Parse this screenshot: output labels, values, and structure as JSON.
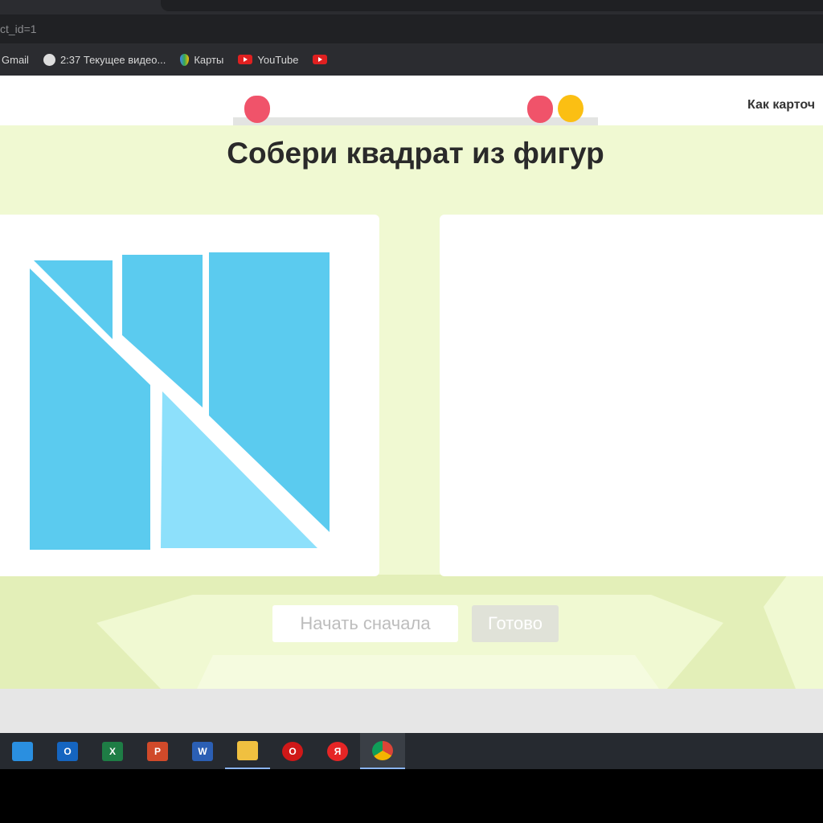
{
  "browser": {
    "address_fragment": "ct_id=1",
    "bookmarks": [
      {
        "label": "Gmail",
        "icon": "gmail-icon"
      },
      {
        "label": "2:37 Текущее видео...",
        "icon": "globe-icon"
      },
      {
        "label": "Карты",
        "icon": "maps-icon"
      },
      {
        "label": "YouTube",
        "icon": "youtube-icon"
      },
      {
        "label": "",
        "icon": "youtube-icon"
      }
    ]
  },
  "header": {
    "howto_link": "Как карточ"
  },
  "game": {
    "title": "Собери квадрат из фигур",
    "restart_button": "Начать сначала",
    "done_button": "Готово",
    "colors": {
      "piece": "#5bcbef",
      "piece_light": "#8de0fb",
      "background": "#f0f9d2"
    }
  },
  "taskbar": {
    "apps": [
      {
        "name": "mail",
        "label": ""
      },
      {
        "name": "outlook",
        "label": "O"
      },
      {
        "name": "excel",
        "label": "X"
      },
      {
        "name": "powerpoint",
        "label": "P"
      },
      {
        "name": "word",
        "label": "W"
      },
      {
        "name": "file-explorer",
        "label": ""
      },
      {
        "name": "opera",
        "label": "O"
      },
      {
        "name": "yandex",
        "label": "Я"
      },
      {
        "name": "chrome",
        "label": ""
      }
    ]
  }
}
